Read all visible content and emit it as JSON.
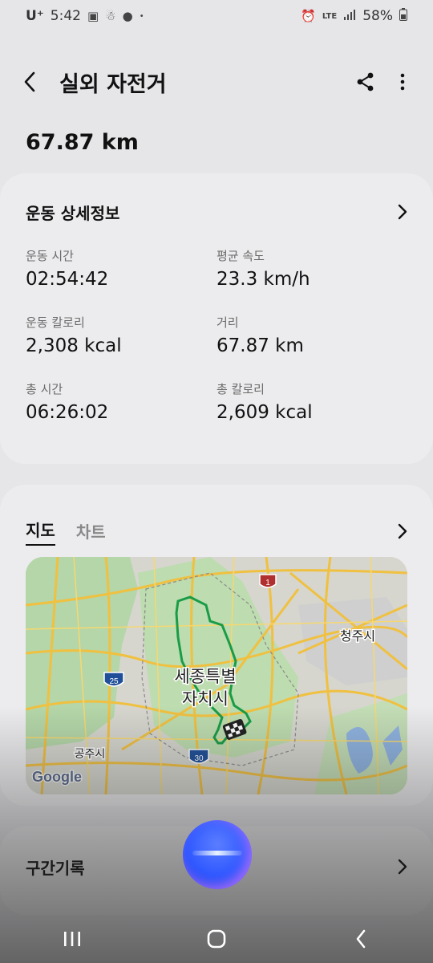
{
  "status_bar": {
    "carrier": "U⁺",
    "time": "5:42",
    "network": "LTE",
    "battery": "58%"
  },
  "header": {
    "title": "실외 자전거"
  },
  "summary": {
    "distance": "67.87 km"
  },
  "details": {
    "title": "운동 상세정보",
    "stats": [
      {
        "label": "운동 시간",
        "value": "02:54:42"
      },
      {
        "label": "평균 속도",
        "value": "23.3 km/h"
      },
      {
        "label": "운동 칼로리",
        "value": "2,308 kcal"
      },
      {
        "label": "거리",
        "value": "67.87 km"
      },
      {
        "label": "총 시간",
        "value": "06:26:02"
      },
      {
        "label": "총 칼로리",
        "value": "2,609 kcal"
      }
    ]
  },
  "map_section": {
    "tabs": [
      {
        "label": "지도",
        "active": true
      },
      {
        "label": "차트",
        "active": false
      }
    ],
    "map_labels": {
      "city1_line1": "세종특별",
      "city1_line2": "자치시",
      "city2": "청주시",
      "city3": "공주시",
      "route_1": "1",
      "route_25": "25",
      "route_30": "30",
      "attribution": "Google"
    },
    "colors": {
      "route": "#1a9c47",
      "road": "#f3c03c"
    }
  },
  "sections": {
    "title": "구간기록"
  },
  "icons": {
    "back": "chevron-left-icon",
    "share": "share-icon",
    "more": "more-vert-icon",
    "assistant": "assistant-bubble-icon"
  }
}
